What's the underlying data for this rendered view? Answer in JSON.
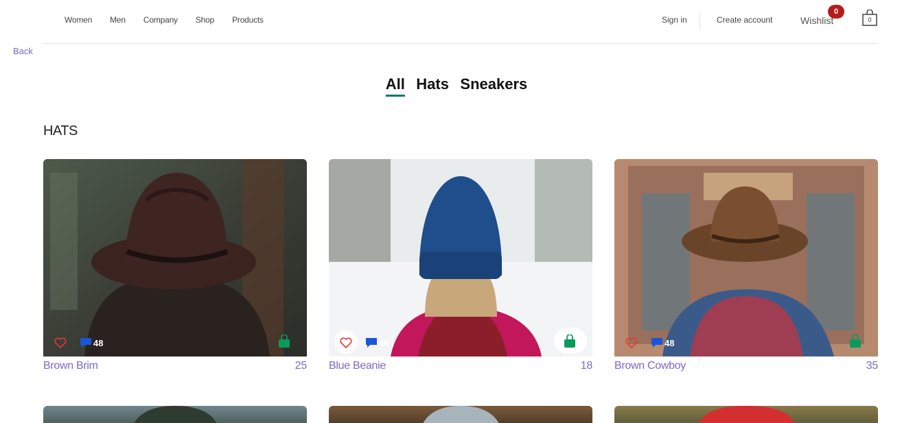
{
  "nav": {
    "links": [
      "Women",
      "Men",
      "Company",
      "Shop",
      "Products"
    ],
    "sign_in": "Sign in",
    "create_account": "Create account",
    "wishlist": "Wishlist",
    "wishlist_count": "0",
    "cart_count": "0"
  },
  "back": "Back",
  "tabs": [
    "All",
    "Hats",
    "Sneakers"
  ],
  "section_title": "HATS",
  "products": [
    {
      "name": "Brown Brim",
      "price": "25",
      "comments": "48"
    },
    {
      "name": "Blue Beanie",
      "price": "18",
      "comments": "48"
    },
    {
      "name": "Brown Cowboy",
      "price": "35",
      "comments": "48"
    }
  ],
  "colors": {
    "accent": "#7b68c8",
    "tab_underline": "#00796b",
    "badge": "#b71c1c",
    "comment_icon": "#1a56db",
    "shop_icon": "#0a9a5c",
    "heart": "#e53935"
  }
}
